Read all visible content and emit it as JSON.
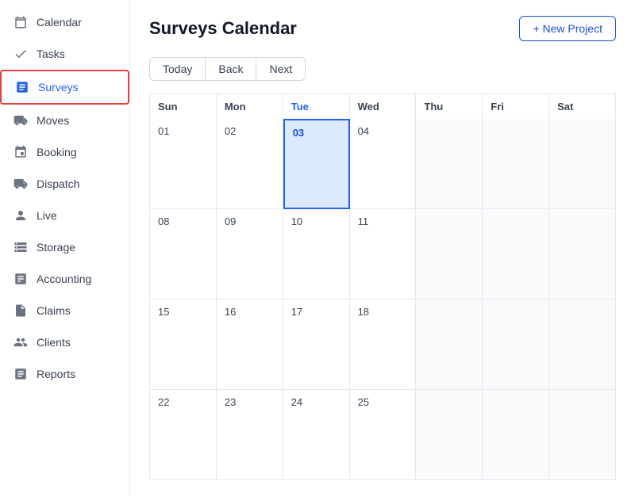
{
  "sidebar": {
    "items": [
      {
        "id": "calendar",
        "label": "Calendar",
        "icon": "calendar"
      },
      {
        "id": "tasks",
        "label": "Tasks",
        "icon": "tasks"
      },
      {
        "id": "surveys",
        "label": "Surveys",
        "icon": "surveys",
        "active": true
      },
      {
        "id": "moves",
        "label": "Moves",
        "icon": "moves"
      },
      {
        "id": "booking",
        "label": "Booking",
        "icon": "booking"
      },
      {
        "id": "dispatch",
        "label": "Dispatch",
        "icon": "dispatch"
      },
      {
        "id": "live",
        "label": "Live",
        "icon": "live"
      },
      {
        "id": "storage",
        "label": "Storage",
        "icon": "storage"
      },
      {
        "id": "accounting",
        "label": "Accounting",
        "icon": "accounting"
      },
      {
        "id": "claims",
        "label": "Claims",
        "icon": "claims"
      },
      {
        "id": "clients",
        "label": "Clients",
        "icon": "clients"
      },
      {
        "id": "reports",
        "label": "Reports",
        "icon": "reports"
      }
    ]
  },
  "header": {
    "title": "Surveys Calendar",
    "new_project_label": "+ New Project"
  },
  "nav": {
    "today": "Today",
    "back": "Back",
    "next": "Next"
  },
  "calendar": {
    "columns": [
      "Sun",
      "Mon",
      "Tue",
      "Wed",
      "Thu",
      "Fri",
      "Sat"
    ],
    "today_col": "Tue",
    "rows": [
      [
        "01",
        "02",
        "03",
        "04",
        "",
        "",
        ""
      ],
      [
        "08",
        "09",
        "10",
        "11",
        "",
        "",
        ""
      ],
      [
        "15",
        "16",
        "17",
        "18",
        "",
        "",
        ""
      ],
      [
        "22",
        "23",
        "24",
        "25",
        "",
        "",
        ""
      ]
    ],
    "today_date": "03"
  }
}
